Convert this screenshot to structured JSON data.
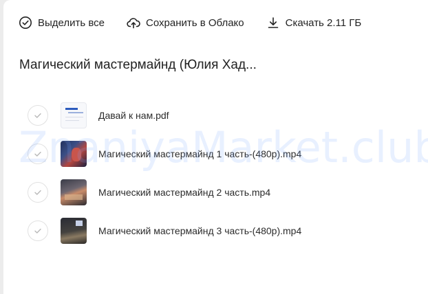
{
  "toolbar": {
    "select_all_label": "Выделить все",
    "save_cloud_label": "Сохранить в Облако",
    "download_label": "Скачать 2.11 ГБ"
  },
  "folder": {
    "title": "Магический мастермайнд (Юлия Хад..."
  },
  "files": [
    {
      "name": "Давай к нам.pdf",
      "type": "pdf"
    },
    {
      "name": "Магический мастермайнд 1 часть-(480p).mp4",
      "type": "video"
    },
    {
      "name": "Магический мастермайнд 2 часть.mp4",
      "type": "video"
    },
    {
      "name": "Магический мастермайнд 3 часть-(480p).mp4",
      "type": "video"
    }
  ],
  "watermark": "ZnaniyaMarket.club",
  "icons": {
    "select_all": "check-circle-icon",
    "save_cloud": "cloud-upload-icon",
    "download": "download-icon",
    "row_check": "check-icon"
  },
  "colors": {
    "background": "#ececec",
    "card": "#ffffff",
    "text": "#222222",
    "check_border": "#e1e1e1",
    "watermark": "#78a5ff"
  }
}
